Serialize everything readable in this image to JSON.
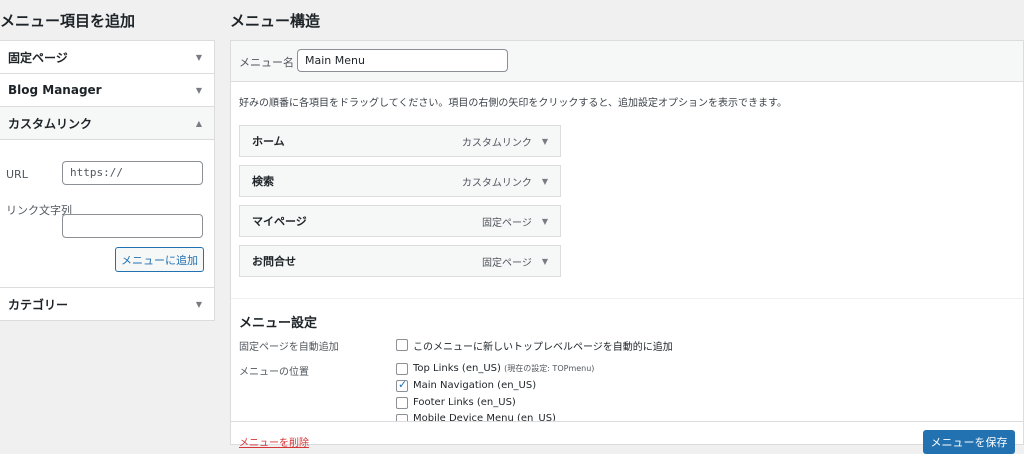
{
  "left": {
    "heading": "メニュー項目を追加",
    "accordion": [
      {
        "label": "固定ページ"
      },
      {
        "label": "Blog Manager"
      },
      {
        "label": "カスタムリンク"
      },
      {
        "label": "カテゴリー"
      }
    ],
    "custom_link": {
      "url_label": "URL",
      "url_value": "https://",
      "text_label": "リンク文字列",
      "text_value": "",
      "add_button": "メニューに追加"
    }
  },
  "right": {
    "heading": "メニュー構造",
    "menu_name_label": "メニュー名",
    "menu_name_value": "Main Menu",
    "instructions": "好みの順番に各項目をドラッグしてください。項目の右側の矢印をクリックすると、追加設定オプションを表示できます。",
    "items": [
      {
        "title": "ホーム",
        "type": "カスタムリンク"
      },
      {
        "title": "検索",
        "type": "カスタムリンク"
      },
      {
        "title": "マイページ",
        "type": "固定ページ"
      },
      {
        "title": "お問合せ",
        "type": "固定ページ"
      }
    ],
    "settings": {
      "heading": "メニュー設定",
      "auto_add_label": "固定ページを自動追加",
      "auto_add_option": "このメニューに新しいトップレベルページを自動的に追加",
      "location_label": "メニューの位置",
      "locations": [
        {
          "label": "Top Links (en_US)",
          "note": "(現在の設定: TOPmenu)",
          "checked": false
        },
        {
          "label": "Main Navigation (en_US)",
          "note": "",
          "checked": true
        },
        {
          "label": "Footer Links (en_US)",
          "note": "",
          "checked": false
        },
        {
          "label": "Mobile Device Menu (en_US)",
          "note": "",
          "checked": false
        }
      ]
    },
    "delete_link": "メニューを削除",
    "save_button": "メニューを保存"
  },
  "colors": {
    "accent": "#2271b1",
    "danger": "#d63638",
    "background": "#f0f0f1"
  }
}
